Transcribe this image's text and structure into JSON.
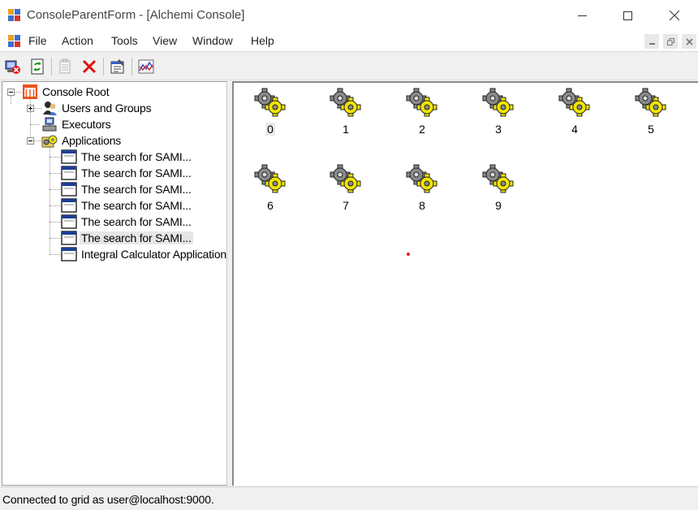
{
  "window": {
    "title": "ConsoleParentForm - [Alchemi Console]",
    "controls": [
      "minimize",
      "maximize",
      "close"
    ]
  },
  "menu": {
    "items": [
      "File",
      "Action",
      "Tools",
      "View",
      "Window",
      "Help"
    ]
  },
  "toolbar": {
    "buttons": [
      {
        "icon": "disconnect-icon"
      },
      {
        "icon": "refresh-icon"
      },
      {
        "icon": "properties-doc-icon",
        "disabled": true
      },
      {
        "icon": "delete-icon"
      },
      {
        "icon": "properties-icon"
      },
      {
        "icon": "performance-chart-icon"
      }
    ]
  },
  "tree": {
    "root": "Console Root",
    "users_groups": "Users and Groups",
    "executors": "Executors",
    "applications": "Applications",
    "apps": [
      "The search for SAMI...",
      "The search for SAMI...",
      "The search for SAMI...",
      "The search for SAMI...",
      "The search for SAMI...",
      "The search for SAMI...",
      "Integral Calculator Application"
    ],
    "selected_index": 5
  },
  "threads": {
    "items": [
      "0",
      "1",
      "2",
      "3",
      "4",
      "5",
      "6",
      "7",
      "8",
      "9"
    ],
    "focused_index": 0,
    "icon": "gear-thread-icon"
  },
  "status": {
    "text": "Connected to grid as user@localhost:9000."
  },
  "colors": {
    "root_icon": "#e8541c",
    "gear_yellow": "#f2e600",
    "gear_gray": "#8a8a8a",
    "delete_red": "#e01010"
  }
}
